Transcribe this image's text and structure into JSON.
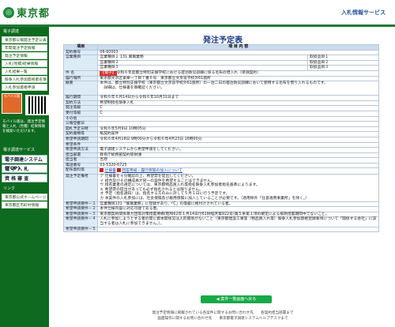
{
  "header": {
    "site": "東京都",
    "service": "入札情報サービス"
  },
  "sidebar": {
    "head1": "電子調達",
    "links": [
      "東京都公報発注予定公表",
      "年間発注予定情報",
      "発注予定情報",
      "入札(見積)結果情報",
      "入札結果一覧",
      "競争入札参加資格者名簿",
      "入札参加資格申請"
    ],
    "mobile_label": "モバイル版",
    "mobile_text": "モバイル版は、発注予定情報と入札（見積）結果情報を検索いただけます。",
    "head2": "電子調達サービス",
    "big": [
      "電子調達システム(TOP)",
      "電 子 入 札",
      "資 格 審 査"
    ],
    "head3": "リンク",
    "links2": [
      "東京都公式ホームページ",
      "東京都区市町村情報"
    ]
  },
  "main": {
    "title": "発注予定表",
    "col_item": "項目",
    "col_content": "項 目 内 容",
    "contract_no_label": "契約番号",
    "contract_no": "06-60003",
    "category_label": "営業種目",
    "cat1": "営業種目１ 131 賞賞業務",
    "cat2": "営業種目２",
    "cat3": "営業種目３",
    "task1": "取扱品目１",
    "task2": "取扱品目２",
    "task3": "取扱品目３",
    "name_label": "件 名",
    "name_badge": "【電子】",
    "name": "令和６年度都立特別支援学校における寝泊防災訓練に係る毛布の借入れ（単価契約）",
    "place_label": "履行場所",
    "place": "東京都文京区後楽一丁目７番６号　東京都立文京盲学校外61箇所",
    "summary_label": "概要",
    "summary": "本件は、都立特別支援学校（東京都立文京盲学校外61箇所）の一泊二日の宿泊防災訓練において使用する毛布を借り入れるものです。\n　詳細は、仕様書を御確認ください。",
    "period_label": "履行期間",
    "period": "令和６年６月14日から令和６年10月31日まで",
    "method_label": "契約方法",
    "method": "希望制指名競争入札",
    "form_label": "発注等級",
    "form": "C",
    "recv_label": "受付等級",
    "recv": "C",
    "other_label": "その他",
    "other": "",
    "notice_label": "公報登載日",
    "notice": "",
    "open_label": "開札予定日時",
    "open": "令和６年5月9日 10時05分",
    "contract_form_label": "契約書類等",
    "contract_form": "紙契約案件",
    "req_period_label": "希望申請期間",
    "req_period": "令和６年4月18日 9時00分から令和６年4月23日 16時00分",
    "req_cond_label": "希望条件",
    "req_cond": "",
    "req_method_label": "希望申請方法",
    "req_method": "電子調達システムから希望申請をしてください。",
    "dept_label": "担当部署",
    "dept": "教育庁総務部契約管財課",
    "person_label": "担当者",
    "person": "吉原",
    "tel_label": "電話番号",
    "tel": "03-5320-6725",
    "doc_label": "配布資料等",
    "doc1": "仕様書",
    "doc2": "回答用紙・履行保険の加入について",
    "req_label": "発注予定備考",
    "req": "ア 仕様書を十分確認の上、希望票を提出してください。\nイ 結合及びその構成員が同一の案件を希望することはできません。\nウ 指名業者の選定については、東京都物品買入れ等指名競争入札参加者指名基準によります。\nエ 希望票の提出があっても必ず指名されるとは限りません。\nオ 予定（指名通知）は、指名する方のみに対して５月１日に行う予定です。\nカ 本案件の入札参加には、社会保険及び雇用保険に加入していることが必要です。（適用除外「任意適用事業所」を除く。）",
    "c1_label": "希望申請要件－１",
    "c1": "営業種目131「賞賞業務」に登録があり、「C」の等級に格付けされている者。",
    "c2_label": "希望申請要件－２",
    "c2": "本件仕様内容に対応可能である者。",
    "c3_label": "希望申請要件－３",
    "c3": "東京都契約関係暴力団等対策措置要綱(昭和62年１月14日付61財経庶第922号)第５条第１項の規定による排除措置期間中でないこと。",
    "c4_label": "希望申請要件－４",
    "c4": "入札に参加しようとする者の間に資本関係又は人的関係がないこと（東京都建設工事等（物品買入れ等）競争入札参加資格登録事項について「関係する会社」に該当する者は入札に参加できません。）。",
    "c5_label": "希望申請要件－５",
    "c5": "",
    "back": "案件一覧画面へ戻る",
    "foot1": "発注予定情報に掲載されている各案件に関するお問い合わせ先　　各契約担当部署まで",
    "foot2": "画面操作に関するお問い合わせ先　　東京都電子調達システムヘルプデスクまで"
  }
}
